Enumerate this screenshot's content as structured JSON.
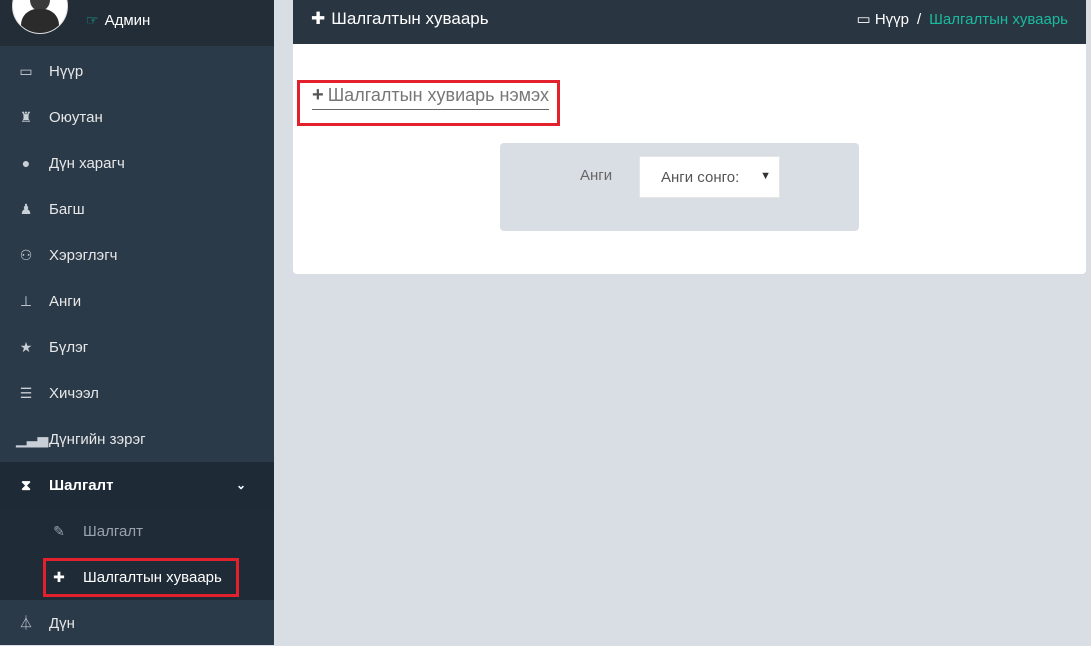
{
  "sidebar": {
    "user_name": "Админ",
    "menu": [
      {
        "label": "Нүүр",
        "icon": "laptop-icon"
      },
      {
        "label": "Оюутан",
        "icon": "graduate-icon"
      },
      {
        "label": "Дүн харагч",
        "icon": "user-icon"
      },
      {
        "label": "Багш",
        "icon": "teacher-icon"
      },
      {
        "label": "Хэрэглэгч",
        "icon": "users-icon"
      },
      {
        "label": "Анги",
        "icon": "sitemap-icon"
      },
      {
        "label": "Бүлэг",
        "icon": "star-icon"
      },
      {
        "label": "Хичээл",
        "icon": "book-icon"
      },
      {
        "label": "Дүнгийн зэрэг",
        "icon": "signal-icon"
      },
      {
        "label": "Шалгалт",
        "icon": "hourglass-icon"
      },
      {
        "label": "Дүн",
        "icon": "flask-icon"
      }
    ],
    "submenu": [
      {
        "label": "Шалгалт",
        "icon": "pencil-icon"
      },
      {
        "label": "Шалгалтын хуваарь",
        "icon": "puzzle-icon"
      }
    ]
  },
  "header": {
    "title": "Шалгалтын хуваарь",
    "breadcrumb_home": "Нүүр",
    "breadcrumb_sep": "/",
    "breadcrumb_current": "Шалгалтын хуваарь"
  },
  "main": {
    "add_link": "Шалгалтын хувиарь нэмэх",
    "filter_label": "Анги",
    "filter_select": "Анги сонго:"
  },
  "colors": {
    "sidebar": "#2b3a49",
    "accent": "#1abb9c",
    "highlight": "#e3212d"
  }
}
